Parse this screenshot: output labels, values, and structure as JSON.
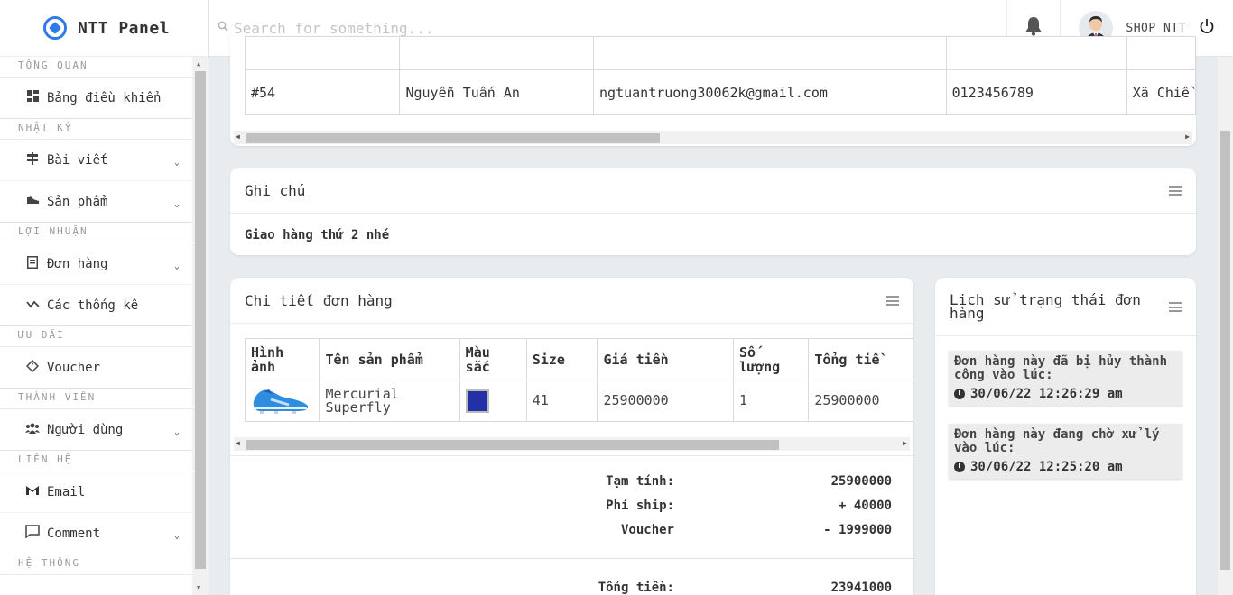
{
  "brand": {
    "name": "NTT Panel"
  },
  "search": {
    "placeholder": "Search for something..."
  },
  "user": {
    "name": "SHOP NTT"
  },
  "sidebar": {
    "sections": [
      {
        "title": "TỔNG QUAN",
        "items": [
          {
            "label": "Bảng điều khiển",
            "icon": "dashboard-icon"
          }
        ]
      },
      {
        "title": "NHẬT KÝ",
        "items": [
          {
            "label": "Bài viết",
            "icon": "signpost-icon",
            "expandable": true
          },
          {
            "label": "Sản phẩm",
            "icon": "shoe-icon",
            "expandable": true
          }
        ]
      },
      {
        "title": "LỢI NHUẬN",
        "items": [
          {
            "label": "Đơn hàng",
            "icon": "receipt-icon",
            "expandable": true
          },
          {
            "label": "Các thống kê",
            "icon": "stats-icon"
          }
        ]
      },
      {
        "title": "ƯU ĐÃI",
        "items": [
          {
            "label": "Voucher",
            "icon": "tag-icon"
          }
        ]
      },
      {
        "title": "THÀNH VIÊN",
        "items": [
          {
            "label": "Người dùng",
            "icon": "users-icon",
            "expandable": true
          }
        ]
      },
      {
        "title": "LIÊN HỆ",
        "items": [
          {
            "label": "Email",
            "icon": "gmail-icon"
          },
          {
            "label": "Comment",
            "icon": "comment-icon",
            "expandable": true
          }
        ]
      },
      {
        "title": "HỆ THỐNG",
        "items": []
      }
    ]
  },
  "customer": {
    "row": [
      "#54",
      "Nguyễn Tuấn An",
      "ngtuantruong30062k@gmail.com",
      "0123456789",
      "Xã Chiề"
    ]
  },
  "note": {
    "title": "Ghi chú",
    "body": "Giao hàng thứ 2 nhé"
  },
  "detail": {
    "title": "Chi tiết đơn hàng",
    "headers": [
      "Hình ảnh",
      "Tên sản phẩm",
      "Màu sắc",
      "Size",
      "Giá tiền",
      "Số lượng",
      "Tổng tiề"
    ],
    "rows": [
      {
        "image": "football-boot-image",
        "name": "Mercurial Superfly",
        "color": "#2431a6",
        "size": "41",
        "price": "25900000",
        "qty": "1",
        "total": "25900000"
      }
    ],
    "subtotal_label": "Tạm tính:",
    "subtotal": "25900000",
    "shipping_label": "Phí ship:",
    "shipping": "+ 40000",
    "voucher_label": "Voucher",
    "voucher": "- 1999000",
    "total_label": "Tổng tiền:",
    "total": "23941000"
  },
  "history": {
    "title": "Lịch sử trạng thái đơn hàng",
    "items": [
      {
        "text": "Đơn hàng này đã bị hủy thành công vào lúc:",
        "time": "30/06/22 12:26:29 am"
      },
      {
        "text": "Đơn hàng này đang chờ xử lý vào lúc:",
        "time": "30/06/22 12:25:20 am"
      }
    ]
  },
  "colors": {
    "accent": "#2e7be6",
    "background": "#e9ecef"
  }
}
